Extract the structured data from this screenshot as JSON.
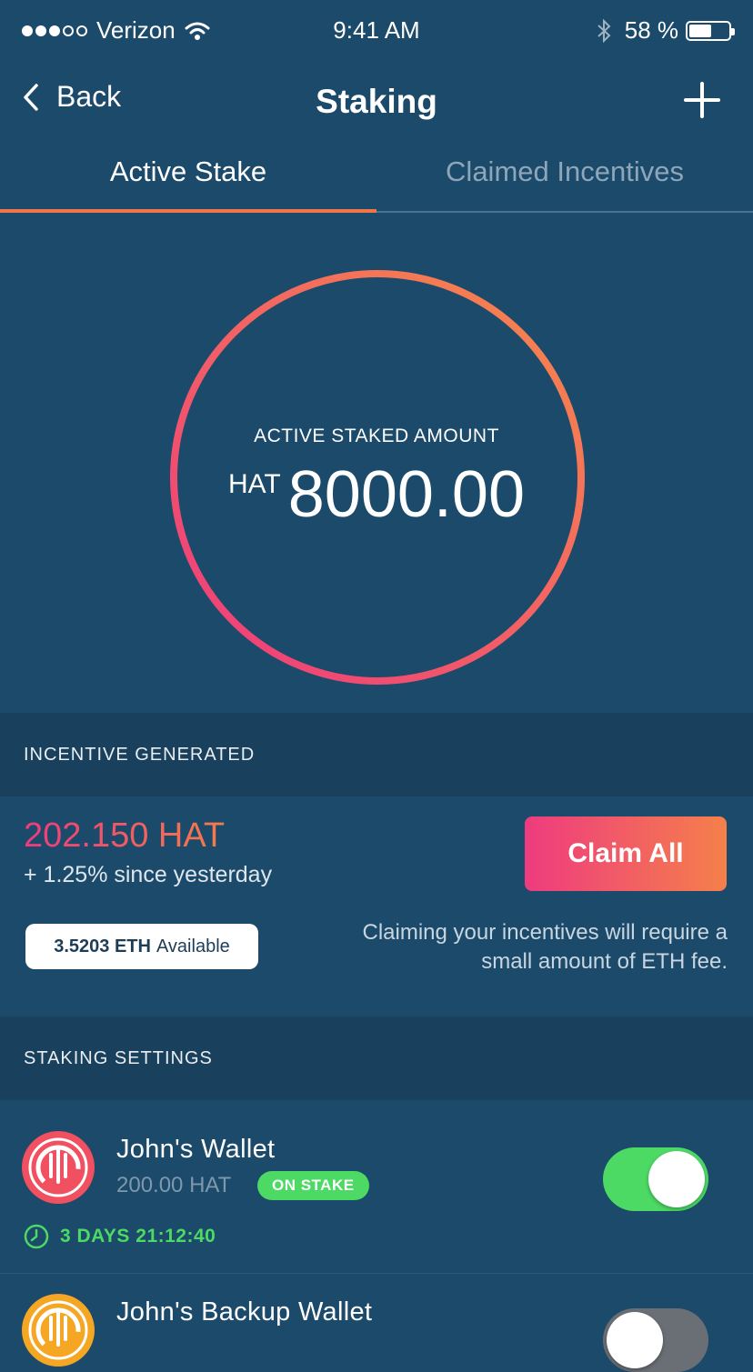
{
  "status_bar": {
    "carrier": "Verizon",
    "time": "9:41 AM",
    "battery": "58 %",
    "battery_level": 0.58
  },
  "nav": {
    "back_label": "Back",
    "title": "Staking"
  },
  "tabs": [
    {
      "label": "Active Stake",
      "active": true
    },
    {
      "label": "Claimed Incentives",
      "active": false
    }
  ],
  "stake": {
    "label": "ACTIVE STAKED AMOUNT",
    "unit": "HAT",
    "value": "8000.00"
  },
  "incentive": {
    "header": "INCENTIVE GENERATED",
    "amount": "202.150 HAT",
    "change": "+ 1.25% since yesterday",
    "claim_label": "Claim All",
    "eth_amount": "3.5203 ETH",
    "eth_suffix": "Available",
    "fee_note": "Claiming your incentives will require a small amount of ETH fee."
  },
  "settings": {
    "header": "STAKING SETTINGS",
    "wallets": [
      {
        "name": "John's Wallet",
        "amount": "200.00 HAT",
        "badge": "ON STAKE",
        "timer": "3 DAYS 21:12:40",
        "enabled": true,
        "logo_color": "#f0505f"
      },
      {
        "name": "John's Backup Wallet",
        "enabled": false,
        "logo_color": "#f5a623"
      }
    ]
  },
  "colors": {
    "background": "#1b4a6b",
    "section": "#19405c",
    "accent_pink": "#ee3a7e",
    "accent_orange": "#f47d49",
    "green": "#4cd964"
  },
  "icons": [
    "wifi-icon",
    "bluetooth-icon",
    "battery-icon",
    "back-chevron-icon",
    "plus-icon",
    "clock-icon",
    "wallet-logo-icon"
  ]
}
